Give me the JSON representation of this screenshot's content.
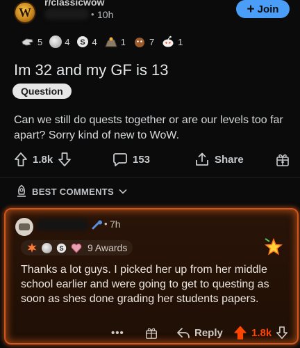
{
  "header": {
    "subreddit": "r/classicwow",
    "subreddit_icon_letter": "W",
    "time": "10h",
    "join_label": "Join",
    "join_color": "#4a9ef7"
  },
  "post_awards": [
    {
      "icon": "award-pointing-hand-icon",
      "count": "5"
    },
    {
      "icon": "award-silver-face-icon",
      "count": "4"
    },
    {
      "icon": "award-s-coin-icon",
      "count": "4"
    },
    {
      "icon": "award-rock-icon",
      "count": "1"
    },
    {
      "icon": "award-brown-figure-icon",
      "count": "7"
    },
    {
      "icon": "award-snoo-face-icon",
      "count": "1"
    }
  ],
  "post": {
    "title": "Im 32 and my GF is 13",
    "flair": "Question",
    "body": "Can we still do quests together or are our levels too far apart? Sorry kind of new to WoW."
  },
  "actions": {
    "votes": "1.8k",
    "comments": "153",
    "share": "Share"
  },
  "sort": {
    "label": "BEST COMMENTS"
  },
  "comment": {
    "time": "7h",
    "awards_label": "9 Awards",
    "text": "Thanks a lot guys. I picked her up from her middle school earlier and were going to get to questing as soon as shes done grading her students papers.",
    "more": "•••",
    "reply": "Reply",
    "votes": "1.8k",
    "highlight_color": "#d2551c"
  }
}
